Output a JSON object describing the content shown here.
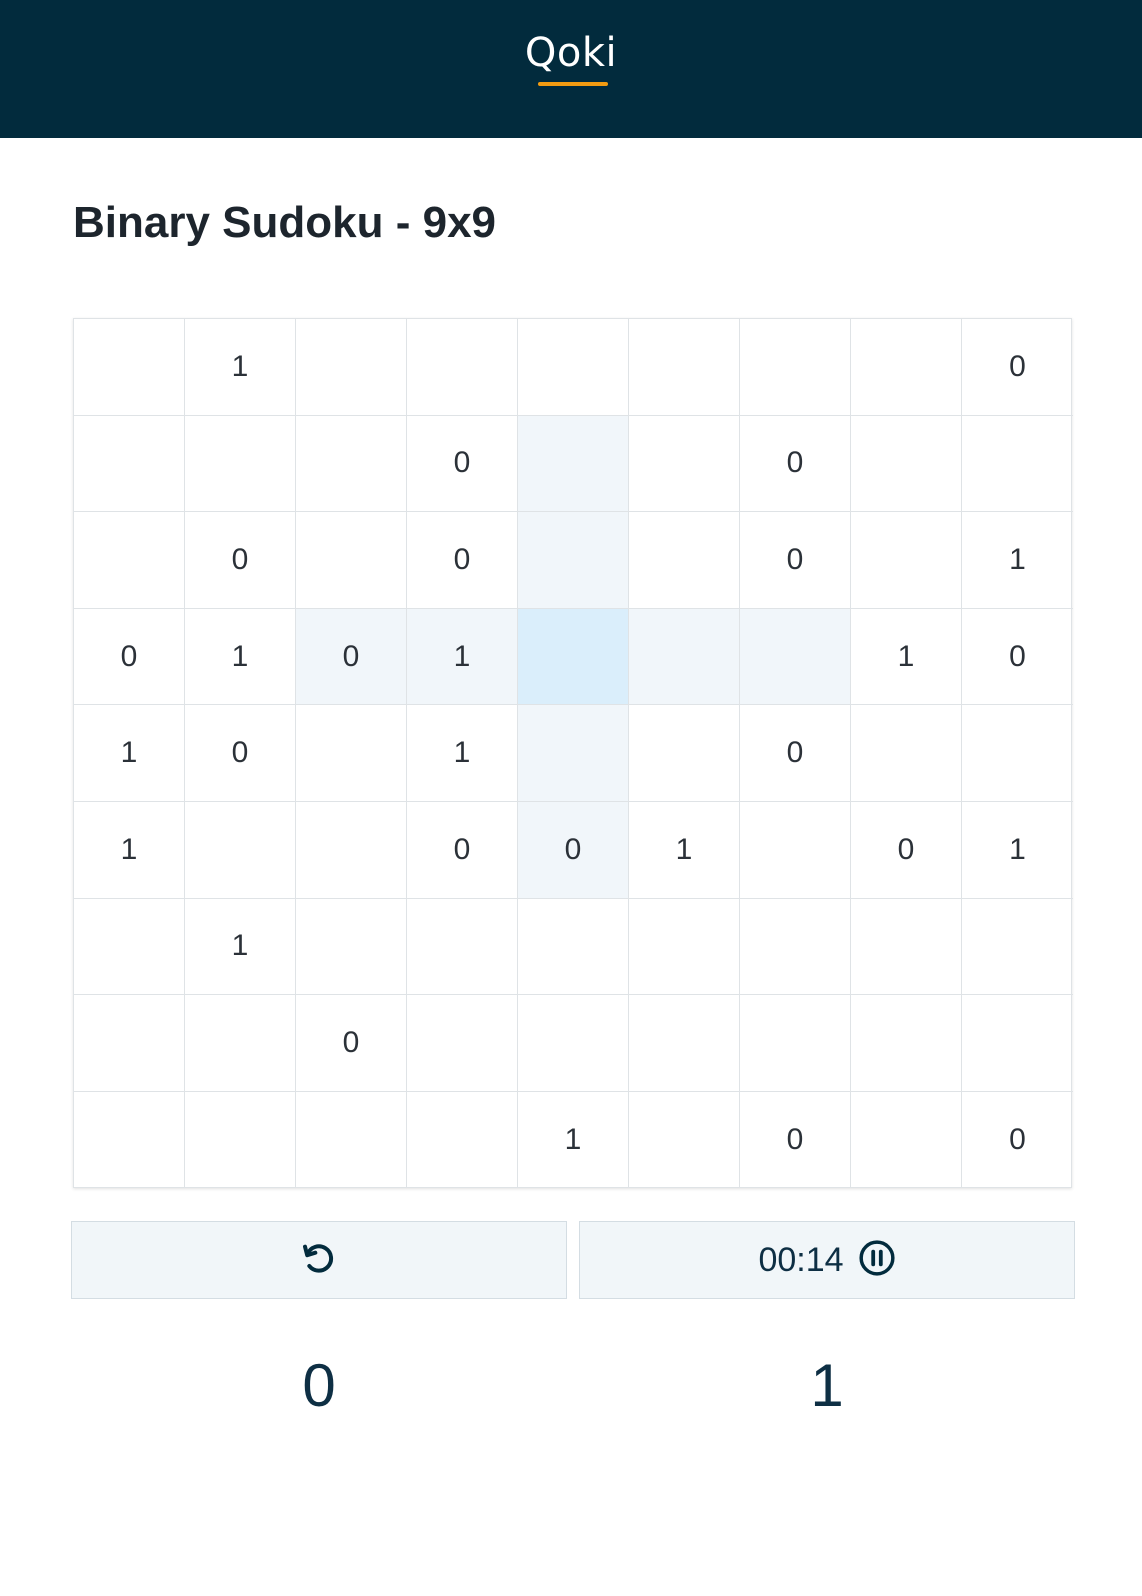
{
  "header": {
    "logo": "Qoki",
    "accent_color": "#f39c12",
    "bg_color": "#022b3d"
  },
  "page": {
    "title": "Binary Sudoku - 9x9"
  },
  "board": {
    "size": 9,
    "selected": {
      "row": 3,
      "col": 4
    },
    "cells": [
      [
        "",
        "1",
        "",
        "",
        "",
        "",
        "",
        "",
        "0"
      ],
      [
        "",
        "",
        "",
        "0",
        "",
        "",
        "0",
        "",
        ""
      ],
      [
        "",
        "0",
        "",
        "0",
        "",
        "",
        "0",
        "",
        "1"
      ],
      [
        "0",
        "1",
        "0",
        "1",
        "",
        "",
        "",
        "1",
        "0"
      ],
      [
        "1",
        "0",
        "",
        "1",
        "",
        "",
        "0",
        "",
        ""
      ],
      [
        "1",
        "",
        "",
        "0",
        "0",
        "1",
        "",
        "0",
        "1"
      ],
      [
        "",
        "1",
        "",
        "",
        "",
        "",
        "",
        "",
        ""
      ],
      [
        "",
        "",
        "0",
        "",
        "",
        "",
        "",
        "",
        ""
      ],
      [
        "",
        "",
        "",
        "",
        "1",
        "",
        "0",
        "",
        "0"
      ]
    ]
  },
  "controls": {
    "reset_icon": "reset-icon",
    "timer": "00:14",
    "pause_icon": "pause-icon"
  },
  "input": {
    "zero_label": "0",
    "one_label": "1"
  }
}
